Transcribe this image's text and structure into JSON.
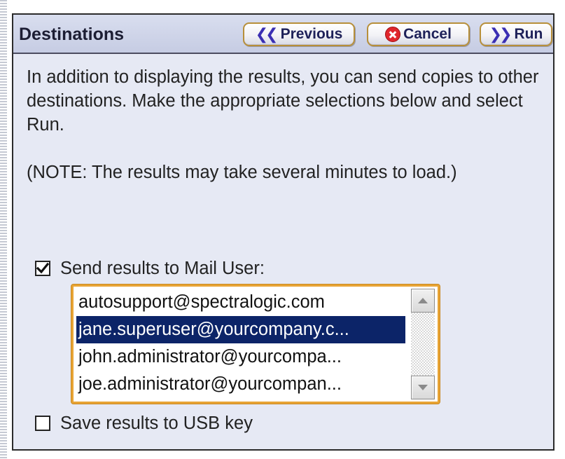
{
  "header": {
    "title": "Destinations",
    "previous_label": "Previous",
    "cancel_label": "Cancel",
    "run_label": "Run",
    "previous_icon": "double-chevron-left-icon",
    "cancel_icon": "cancel-circle-icon",
    "run_icon": "double-chevron-right-icon"
  },
  "body": {
    "intro": "In addition to displaying the results, you can send copies to other destinations. Make the appropriate selections below and select Run.",
    "note": "(NOTE: The results may take several minutes to load.)"
  },
  "mail": {
    "label": "Send results to Mail User:",
    "checked": true,
    "recipients": [
      {
        "email": "autosupport@spectralogic.com",
        "selected": false
      },
      {
        "email": "jane.superuser@yourcompany.c...",
        "selected": true
      },
      {
        "email": "john.administrator@yourcompa...",
        "selected": false
      },
      {
        "email": "joe.administrator@yourcompan...",
        "selected": false
      }
    ]
  },
  "usb": {
    "label": "Save results to USB key",
    "checked": false
  },
  "colors": {
    "header_bg": "#c6cce3",
    "panel_bg": "#e6e9f4",
    "selection": "#0c2468",
    "focus_border": "#e8a435",
    "cancel_red": "#e0262c",
    "chevron": "#3b2fb3"
  }
}
